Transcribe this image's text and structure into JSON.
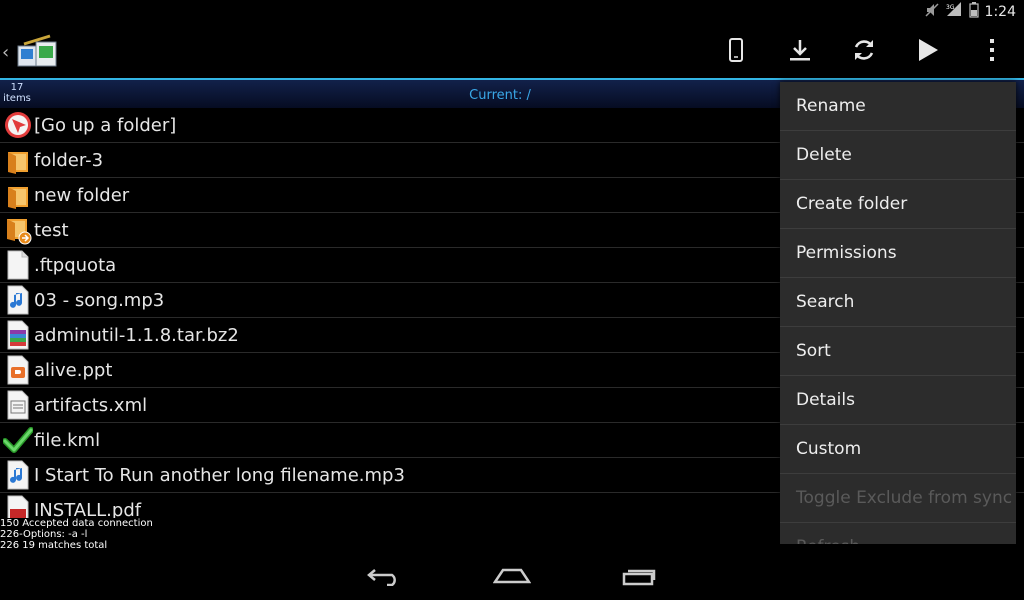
{
  "status_bar": {
    "time": "1:24",
    "network": "3G"
  },
  "action_bar": {
    "icons": [
      "device-icon",
      "download-icon",
      "sync-icon",
      "play-icon",
      "overflow-menu-icon"
    ]
  },
  "info_bar": {
    "items_count": "17",
    "items_label": "items",
    "current": "Current: /"
  },
  "files": [
    {
      "name": "[Go up a folder]",
      "icon": "go-up-icon"
    },
    {
      "name": "folder-3",
      "icon": "folder-icon"
    },
    {
      "name": "new folder",
      "icon": "folder-icon"
    },
    {
      "name": "test",
      "icon": "folder-link-icon"
    },
    {
      "name": ".ftpquota",
      "icon": "file-icon"
    },
    {
      "name": "03 - song.mp3",
      "icon": "audio-file-icon"
    },
    {
      "name": "adminutil-1.1.8.tar.bz2",
      "icon": "archive-file-icon"
    },
    {
      "name": "alive.ppt",
      "icon": "presentation-file-icon"
    },
    {
      "name": "artifacts.xml",
      "icon": "xml-file-icon"
    },
    {
      "name": "file.kml",
      "icon": "checkmark-icon"
    },
    {
      "name": "I Start To Run another long filename.mp3",
      "icon": "audio-file-icon"
    },
    {
      "name": "INSTALL.pdf",
      "icon": "pdf-file-icon"
    }
  ],
  "log": [
    "150 Accepted data connection",
    "226-Options: -a -l",
    "226 19 matches total"
  ],
  "menu": {
    "items": [
      "Rename",
      "Delete",
      "Create folder",
      "Permissions",
      "Search",
      "Sort",
      "Details",
      "Custom",
      "Toggle Exclude from sync",
      "Refresh"
    ]
  },
  "colors": {
    "accent": "#33b5e5",
    "menu_bg": "#2c2c2c",
    "disabled": "#5a5a5a"
  }
}
